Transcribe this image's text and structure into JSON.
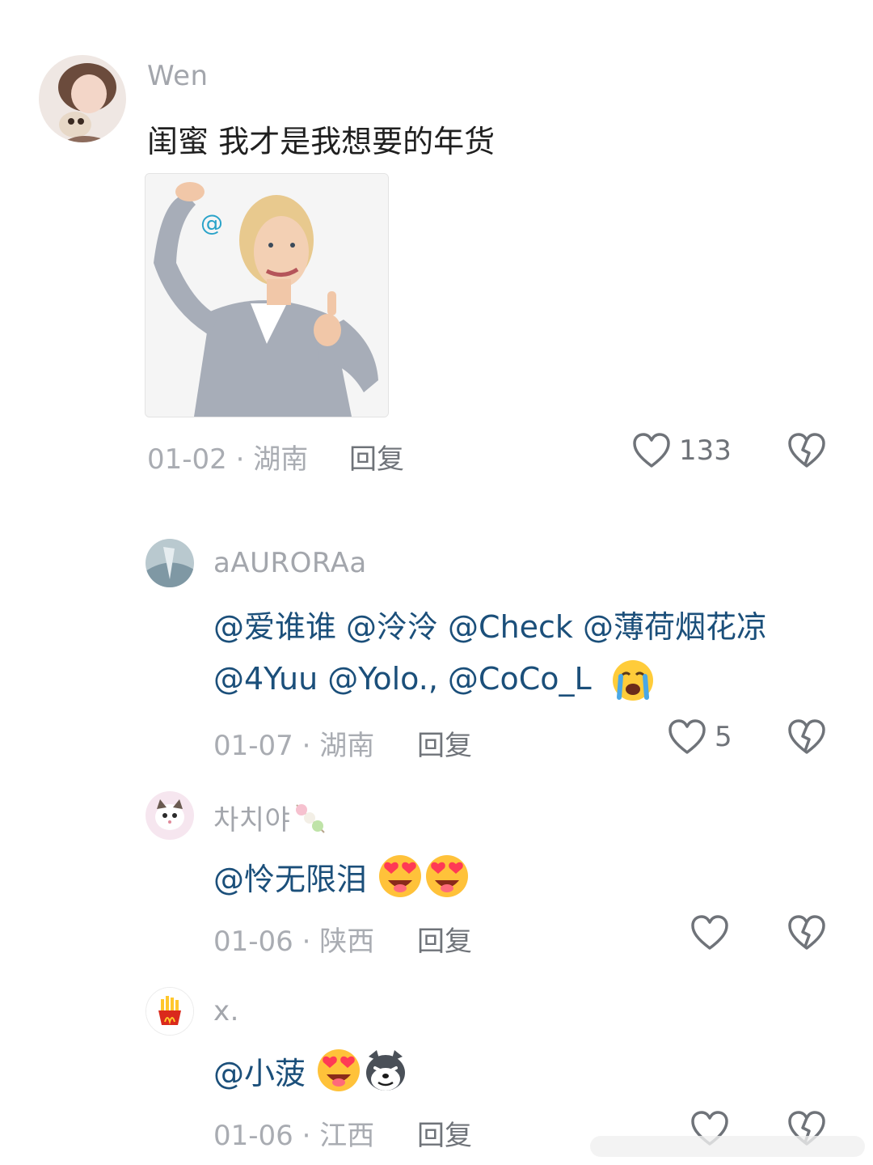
{
  "main_comment": {
    "username": "Wen",
    "text": "闺蜜 我才是我想要的年货",
    "date_location": "01-02 · 湖南",
    "reply": "回复",
    "likes": "133"
  },
  "replies": [
    {
      "username": "aAURORAa",
      "mentions_line1": [
        "@爱谁谁",
        "@泠泠",
        "@Check",
        "@薄荷烟花凉"
      ],
      "mentions_line2": [
        "@4Yuu",
        "@Yolo.,",
        "@CoCo_L"
      ],
      "date_location": "01-07 · 湖南",
      "reply": "回复",
      "likes": "5",
      "emoji": "crying-face"
    },
    {
      "username": "차치야",
      "mention": "@怜无限泪",
      "date_location": "01-06 · 陕西",
      "reply": "回复",
      "likes": "",
      "emoji": "heart-eyes"
    },
    {
      "username": "x.",
      "mention": "@小菠",
      "date_location": "01-06 · 江西",
      "reply": "回复",
      "likes": "",
      "emoji": "heart-eyes"
    }
  ],
  "colors": {
    "mention": "#1b4f7a",
    "meta": "#a9acb2",
    "username": "#a3a6ac"
  },
  "image_overlay": "@"
}
